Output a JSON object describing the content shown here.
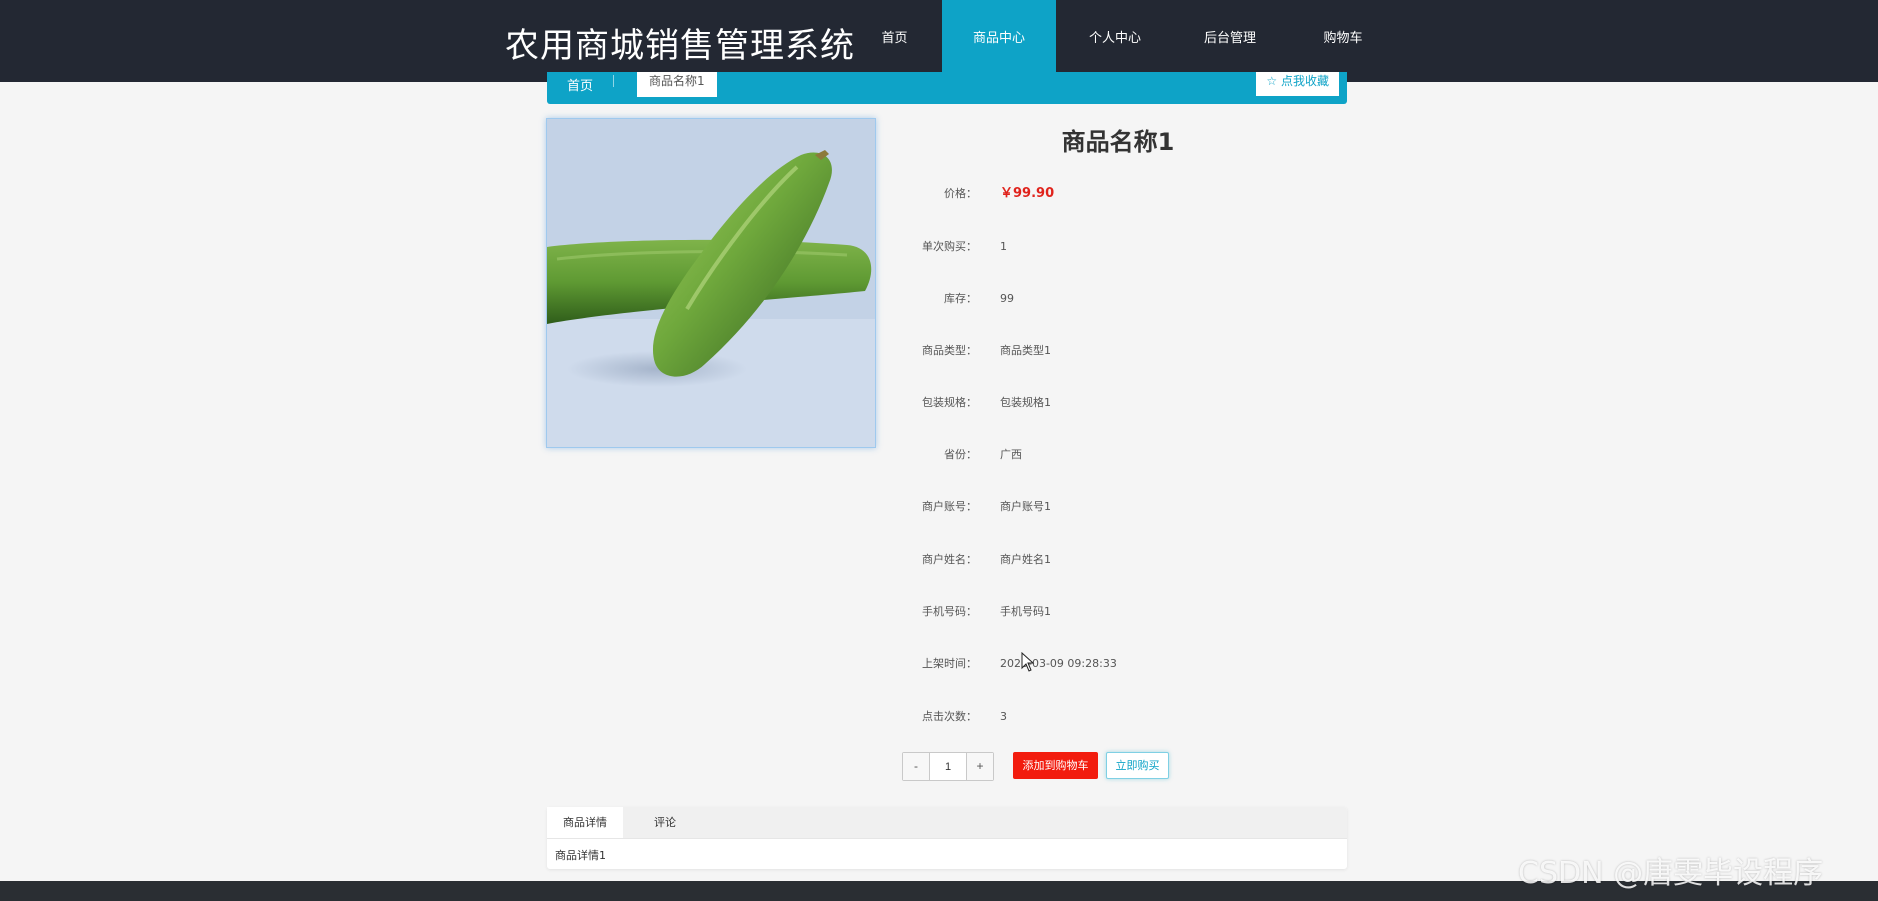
{
  "header": {
    "brand": "农用商城销售管理系统",
    "nav": [
      {
        "label": "首页",
        "active": false
      },
      {
        "label": "商品中心",
        "active": true
      },
      {
        "label": "个人中心",
        "active": false
      },
      {
        "label": "后台管理",
        "active": false
      },
      {
        "label": "购物车",
        "active": false
      }
    ]
  },
  "breadcrumb": {
    "home": "首页",
    "current": "商品名称1",
    "favorite": "☆ 点我收藏"
  },
  "product": {
    "title": "商品名称1",
    "image_alt": "cucumber",
    "attributes": [
      {
        "label": "价格：",
        "value": "￥99.90"
      },
      {
        "label": "单次购买：",
        "value": "1"
      },
      {
        "label": "库存：",
        "value": "99"
      },
      {
        "label": "商品类型：",
        "value": "商品类型1"
      },
      {
        "label": "包装规格：",
        "value": "包装规格1"
      },
      {
        "label": "省份：",
        "value": "广西"
      },
      {
        "label": "商户账号：",
        "value": "商户账号1"
      },
      {
        "label": "商户姓名：",
        "value": "商户姓名1"
      },
      {
        "label": "手机号码：",
        "value": "手机号码1"
      },
      {
        "label": "上架时间：",
        "value": "2023-03-09 09:28:33"
      },
      {
        "label": "点击次数：",
        "value": "3"
      }
    ]
  },
  "purchase": {
    "minus": "-",
    "quantity": "1",
    "plus": "+",
    "add_to_cart": "添加到购物车",
    "buy_now": "立即购买"
  },
  "tabs": {
    "items": [
      {
        "label": "商品详情",
        "active": true
      },
      {
        "label": "评论",
        "active": false
      }
    ],
    "content": "商品详情1"
  },
  "watermark": "CSDN @唐雯毕设程序",
  "colors": {
    "accent": "#0ea3c7",
    "header_bg": "#232833",
    "price": "#e0231c",
    "cart_button": "#f21c0e"
  }
}
